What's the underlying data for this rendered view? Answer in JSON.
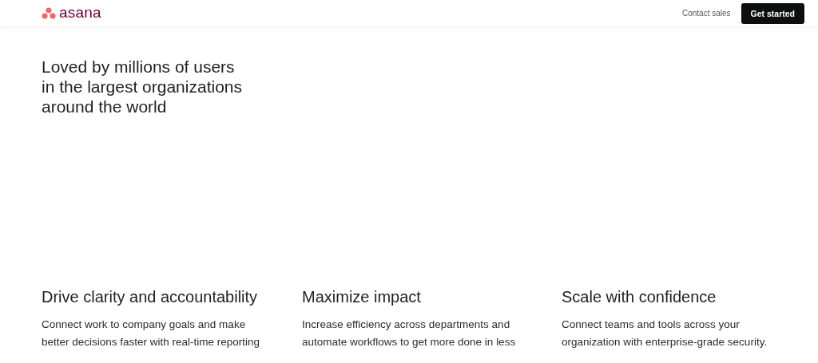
{
  "header": {
    "logo": "asana",
    "links": [
      "Contact sales"
    ],
    "cta": "Get started"
  },
  "hero": {
    "title_lines": [
      "Loved by millions of users",
      "in the largest organizations",
      "around the world"
    ]
  },
  "features": [
    {
      "title": "Drive clarity and accountability",
      "lines": [
        "Connect work to company goals and make",
        "better decisions faster with real-time reporting"
      ]
    },
    {
      "title": "Maximize impact",
      "lines": [
        "Increase efficiency across departments and",
        "automate workflows to get more done in less"
      ]
    },
    {
      "title": "Scale with confidence",
      "lines": [
        "Connect teams and tools across your",
        "organization with enterprise-grade security."
      ]
    }
  ]
}
